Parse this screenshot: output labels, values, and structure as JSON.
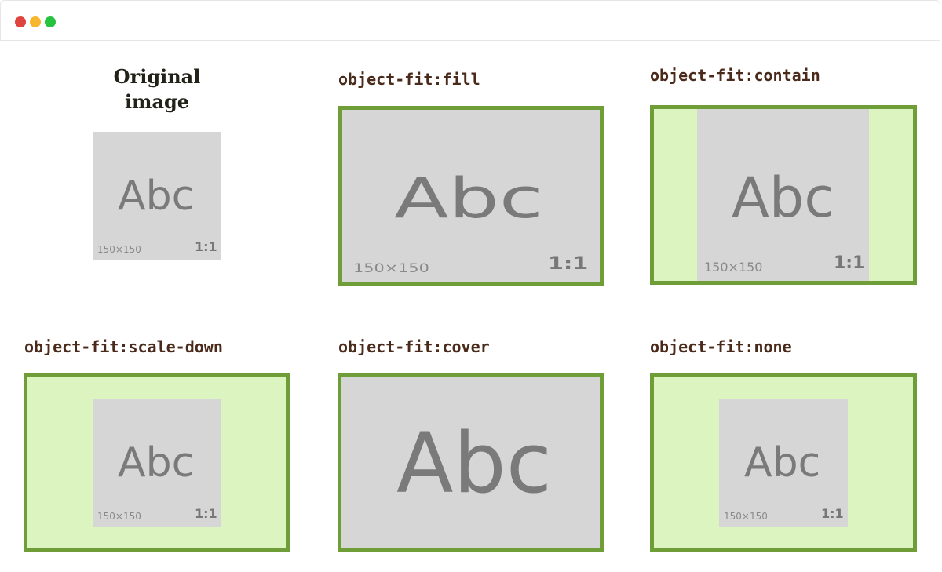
{
  "window": {
    "controls": {
      "close_color": "#e0443e",
      "minimize_color": "#f5b72c",
      "maximize_color": "#25c33f"
    }
  },
  "colors": {
    "frame_border": "#6f9e38",
    "frame_background": "#dcf4c0",
    "image_background": "#d6d6d6",
    "label_text": "#4a2a1a"
  },
  "sample_image": {
    "text": "Abc",
    "dimensions": "150×150",
    "ratio": "1:1"
  },
  "original": {
    "title": "Original image"
  },
  "demos": [
    {
      "label": "object-fit:fill"
    },
    {
      "label": "object-fit:contain"
    },
    {
      "label": "object-fit:scale-down"
    },
    {
      "label": "object-fit:cover"
    },
    {
      "label": "object-fit:none"
    }
  ]
}
